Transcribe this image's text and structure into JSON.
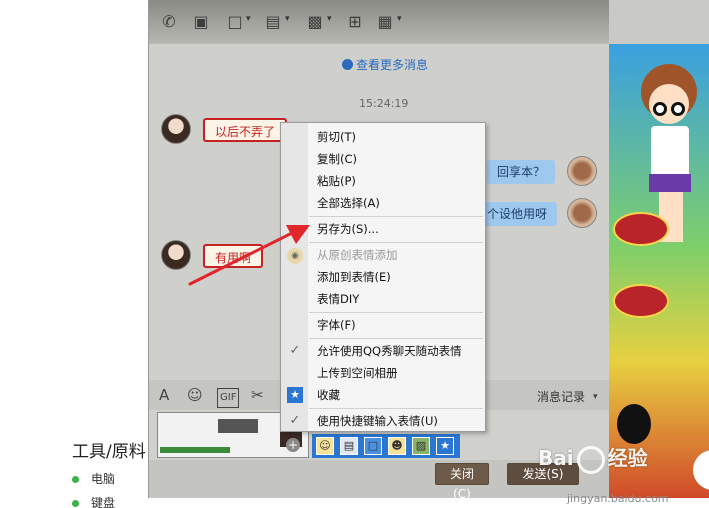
{
  "article": {
    "heading": "工具/原料",
    "items": [
      "电脑",
      "键盘"
    ]
  },
  "chat": {
    "more_messages": "查看更多消息",
    "timestamp": "15:24:19",
    "messages": [
      {
        "side": "left",
        "text": "以后不弄了"
      },
      {
        "side": "right",
        "text": "回享本？"
      },
      {
        "side": "right",
        "text": "个设他用呀"
      },
      {
        "side": "left",
        "text": "有用啊"
      }
    ],
    "message_record": "消息记录",
    "close_button": "关闭(C)",
    "send_button": "发送(S)"
  },
  "context_menu": {
    "items": [
      {
        "label": "剪切(T)",
        "icon": "",
        "disabled": false
      },
      {
        "label": "复制(C)",
        "icon": "",
        "disabled": false
      },
      {
        "label": "粘贴(P)",
        "icon": "",
        "disabled": false
      },
      {
        "label": "全部选择(A)",
        "icon": "",
        "disabled": false
      },
      {
        "label": "另存为(S)...",
        "icon": "",
        "disabled": false
      },
      {
        "label": "从原创表情添加",
        "icon": "palette-icon",
        "disabled": true
      },
      {
        "label": "添加到表情(E)",
        "icon": "",
        "disabled": false
      },
      {
        "label": "表情DIY",
        "icon": "",
        "disabled": false
      },
      {
        "label": "字体(F)",
        "icon": "",
        "disabled": false
      },
      {
        "label": "允许使用QQ秀聊天随动表情",
        "icon": "check-icon",
        "disabled": false
      },
      {
        "label": "上传到空间相册",
        "icon": "",
        "disabled": false
      },
      {
        "label": "收藏",
        "icon": "star-icon",
        "disabled": false
      },
      {
        "label": "使用快捷键输入表情(U)",
        "icon": "check-icon",
        "disabled": false
      }
    ]
  },
  "watermark": {
    "brand": "Bai",
    "brand_suffix": "经验",
    "url": "jingyan.baidu.com"
  },
  "colors": {
    "arrow": "#e0262a",
    "link": "#2a6ac0",
    "bubble_border": "#c62222"
  }
}
